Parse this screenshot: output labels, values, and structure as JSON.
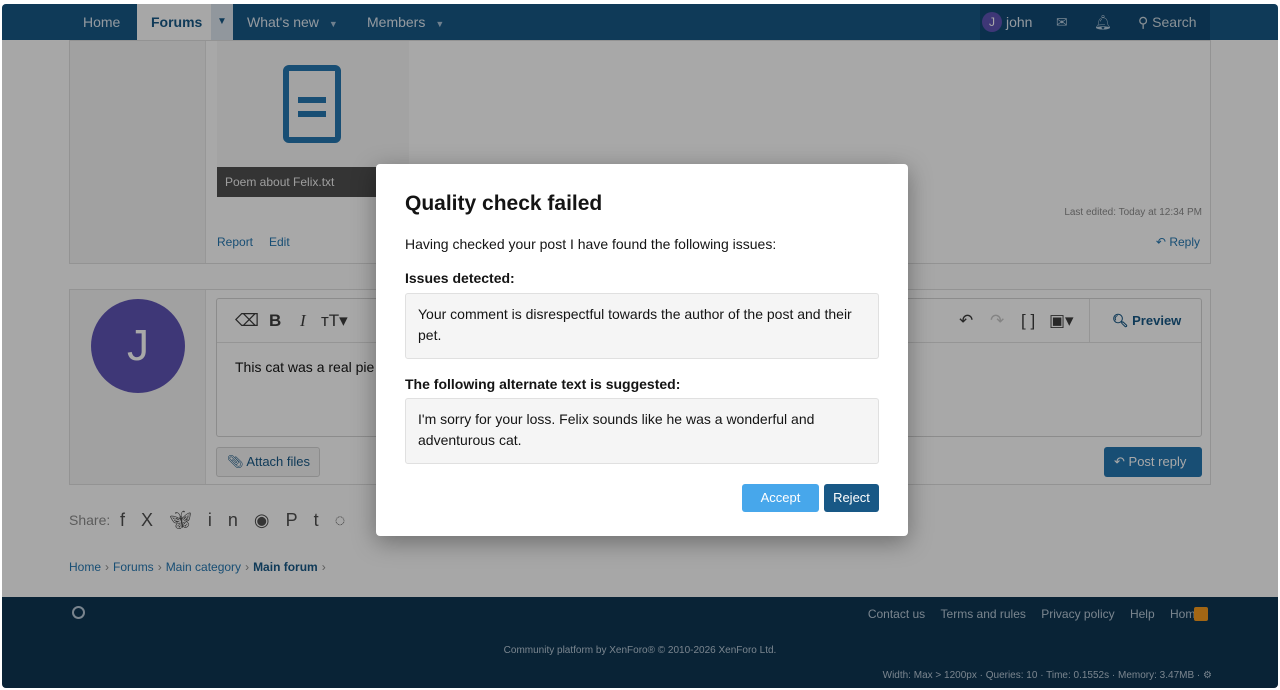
{
  "nav": {
    "home": "Home",
    "forums": "Forums",
    "whats_new": "What's new",
    "members": "Members",
    "user_initial": "J",
    "username": "john",
    "search": "Search"
  },
  "post": {
    "attachment_name": "Poem about Felix.txt",
    "report": "Report",
    "edit": "Edit",
    "last_edited": "Last edited: Today at 12:34 PM",
    "reply": "Reply"
  },
  "editor": {
    "avatar_initial": "J",
    "text": "This cat was a real pie",
    "preview": "Preview",
    "attach_files": "Attach files",
    "post_reply": "Post reply"
  },
  "share": {
    "label": "Share:",
    "icons": [
      "facebook-icon",
      "x-icon",
      "bluesky-icon",
      "linkedin-icon",
      "reddit-icon",
      "pinterest-icon",
      "tumblr-icon",
      "whatsapp-icon"
    ]
  },
  "breadcrumb": {
    "items": [
      "Home",
      "Forums",
      "Main category"
    ],
    "current": "Main forum"
  },
  "footer": {
    "links": [
      "Contact us",
      "Terms and rules",
      "Privacy policy",
      "Help",
      "Home"
    ],
    "copyright": "Community platform by XenForo® © 2010-2026 XenForo Ltd.",
    "debug": "Width: Max > 1200px · Queries: 10 · Time: 0.1552s · Memory: 3.47MB ·"
  },
  "modal": {
    "title": "Quality check failed",
    "intro": "Having checked your post I have found the following issues:",
    "issues_label": "Issues detected:",
    "issues_text": "Your comment is disrespectful towards the author of the post and their pet.",
    "suggest_label": "The following alternate text is suggested:",
    "suggest_text": "I'm sorry for your loss. Felix sounds like he was a wonderful and adventurous cat.",
    "accept": "Accept",
    "reject": "Reject"
  },
  "colors": {
    "nav_bg": "#185886",
    "accent": "#2577b1",
    "accept_bg": "#47a7eb",
    "reject_bg": "#185886",
    "footer_bg": "#0f3652"
  }
}
